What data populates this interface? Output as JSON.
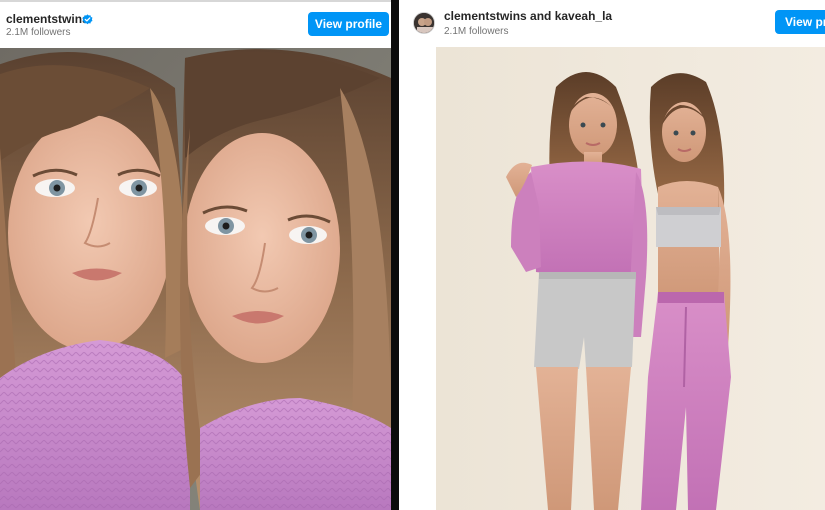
{
  "left_post": {
    "username": "clementstwins",
    "followers": "2.1M followers",
    "view_profile_label": "View profile",
    "verified_icon": "verified-badge-icon",
    "photo": "twin girls with blue eyes in pink knit sweaters"
  },
  "right_post": {
    "username": "clementstwins and kaveah_la",
    "followers": "2.1M followers",
    "view_profile_label": "View profile",
    "avatar_icon": "profile-avatar",
    "photo": "twin teens in pink sweatsuits, grey shorts and pink joggers"
  },
  "colors": {
    "button_blue": "#0095f6",
    "sweater_pink": "#c98ac8",
    "backdrop": "#efe6d8"
  }
}
